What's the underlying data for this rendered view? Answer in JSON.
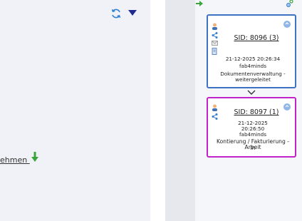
{
  "left": {
    "link_label": "ehmen ",
    "icons": {
      "refresh": "refresh-icon",
      "dropdown": "caret-down-icon",
      "download": "arrow-down-icon"
    }
  },
  "right": {
    "icons": {
      "arrow": "arrow-right-icon",
      "settings": "settings-gears-icon"
    },
    "cards": [
      {
        "sid": "SID: 8096 (3)",
        "date": "21-12-2025 20:26:34",
        "user": "fab4minds",
        "status_line1": "Dokumentenverwaltung -",
        "status_line2": "weitergeleitet",
        "border_color": "#3d73c2"
      },
      {
        "sid": "SID: 8097 (1)",
        "date_line1": "21-12-2025",
        "date_line2": "20:26:50",
        "user": "fab4minds",
        "status_line1": "Kontierung / Fakturierung - In",
        "status_line2": "Arbeit",
        "border_color": "#c023c8"
      }
    ]
  },
  "colors": {
    "accent_blue": "#2f80d3",
    "accent_green": "#3aa53a",
    "blue_border": "#3d73c2",
    "magenta_border": "#c023c8"
  }
}
